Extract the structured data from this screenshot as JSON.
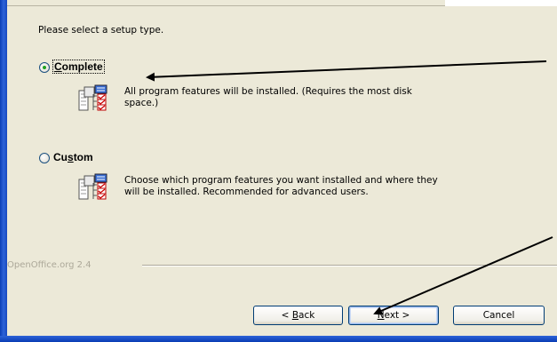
{
  "prompt": "Please select a setup type.",
  "options": [
    {
      "label": "Complete",
      "access_key": "C",
      "label_rest": "omplete",
      "selected": true,
      "description_line1": "All program features will be installed. (Requires the most disk",
      "description_line2": "space.)"
    },
    {
      "label": "Custom",
      "label_pre": "Cu",
      "access_key": "s",
      "label_rest": "tom",
      "selected": false,
      "description_line1": "Choose which program features you want installed and where they",
      "description_line2": "will be installed. Recommended for advanced users."
    }
  ],
  "footer": {
    "brand": "OpenOffice.org 2.4"
  },
  "buttons": {
    "back": {
      "pre": "< ",
      "key": "B",
      "rest": "ack"
    },
    "next": {
      "pre": "",
      "key": "N",
      "rest": "ext >"
    },
    "cancel": "Cancel"
  },
  "colors": {
    "dialog_bg": "#ece9d8",
    "frame_blue": "#0a3db5",
    "radio_dot": "#21a121",
    "muted_text": "#aca899",
    "button_border": "#003c74"
  },
  "icons": {
    "feature": "feature-tree-icon",
    "annotation": "arrow-annotation"
  }
}
